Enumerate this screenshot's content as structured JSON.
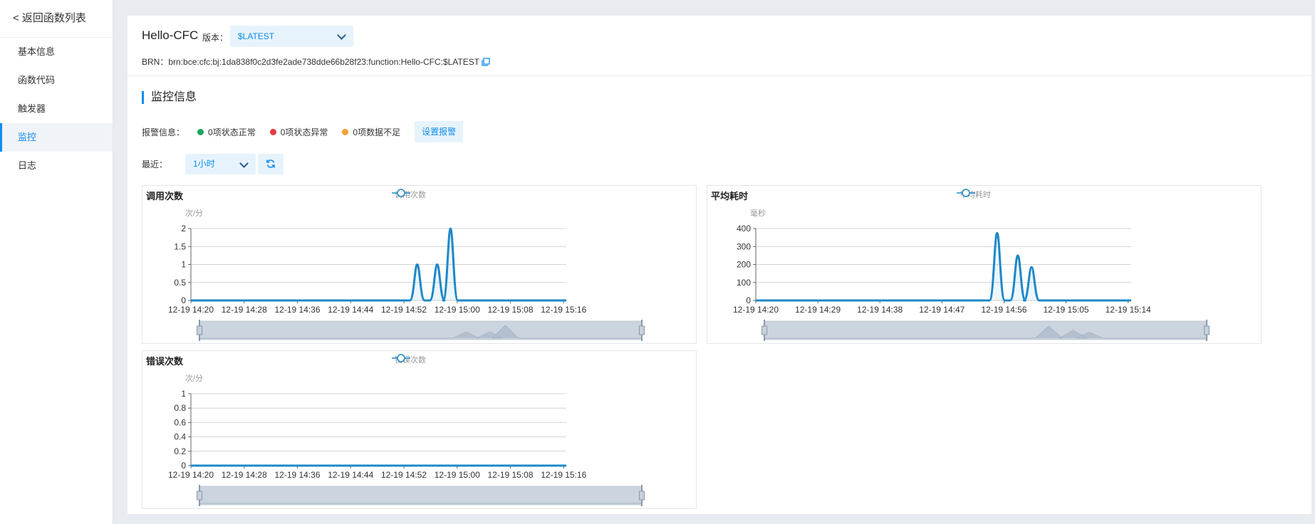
{
  "sidebar": {
    "back_label": "< 返回函数列表",
    "items": [
      {
        "label": "基本信息",
        "active": false
      },
      {
        "label": "函数代码",
        "active": false
      },
      {
        "label": "触发器",
        "active": false
      },
      {
        "label": "监控",
        "active": true
      },
      {
        "label": "日志",
        "active": false
      }
    ]
  },
  "header": {
    "function_name": "Hello-CFC",
    "version_label": "版本：",
    "version_value": "$LATEST",
    "brn_label": "BRN：",
    "brn_value": "brn:bce:cfc:bj:1da838f0c2d3fe2ade738dde66b28f23:function:Hello-CFC:$LATEST"
  },
  "monitor": {
    "section_title": "监控信息",
    "alarm_label": "报警信息：",
    "alarm_items": [
      {
        "text": "0项状态正常",
        "color": "#15a85a"
      },
      {
        "text": "0项状态异常",
        "color": "#e8393d"
      },
      {
        "text": "0项数据不足",
        "color": "#f4a22d"
      }
    ],
    "alarm_button": "设置报警",
    "recent_label": "最近：",
    "recent_value": "1小时"
  },
  "colors": {
    "accent": "#108cee",
    "line": "#1e88c8"
  },
  "chart_data": [
    {
      "type": "line",
      "title": "调用次数",
      "series": [
        {
          "name": "调用次数"
        }
      ],
      "ylabel": "次/分",
      "yticks": [
        "0",
        "0.5",
        "1",
        "1.5",
        "2"
      ],
      "ylim": [
        0,
        2
      ],
      "xticks": [
        "12-19 14:20",
        "12-19 14:28",
        "12-19 14:36",
        "12-19 14:44",
        "12-19 14:52",
        "12-19 15:00",
        "12-19 15:08",
        "12-19 15:16"
      ],
      "peaks": [
        {
          "x": "12-19 14:54",
          "y": 1
        },
        {
          "x": "12-19 14:57",
          "y": 1
        },
        {
          "x": "12-19 14:59",
          "y": 2
        }
      ]
    },
    {
      "type": "line",
      "title": "平均耗时",
      "series": [
        {
          "name": "平均耗时"
        }
      ],
      "ylabel": "毫秒",
      "yticks": [
        "0",
        "100",
        "200",
        "300",
        "400"
      ],
      "ylim": [
        0,
        400
      ],
      "xticks": [
        "12-19 14:20",
        "12-19 14:29",
        "12-19 14:38",
        "12-19 14:47",
        "12-19 14:56",
        "12-19 15:05",
        "12-19 15:14"
      ],
      "peaks": [
        {
          "x": "12-19 14:55",
          "y": 375
        },
        {
          "x": "12-19 14:58",
          "y": 250
        },
        {
          "x": "12-19 15:00",
          "y": 185
        }
      ]
    },
    {
      "type": "line",
      "title": "错误次数",
      "series": [
        {
          "name": "错误次数"
        }
      ],
      "ylabel": "次/分",
      "yticks": [
        "0",
        "0.2",
        "0.4",
        "0.6",
        "0.8",
        "1"
      ],
      "ylim": [
        0,
        1
      ],
      "xticks": [
        "12-19 14:20",
        "12-19 14:28",
        "12-19 14:36",
        "12-19 14:44",
        "12-19 14:52",
        "12-19 15:00",
        "12-19 15:08",
        "12-19 15:16"
      ],
      "peaks": []
    }
  ]
}
